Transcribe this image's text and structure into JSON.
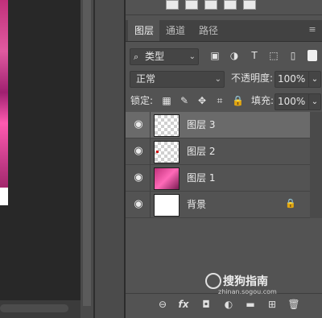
{
  "panel": {
    "tabs": [
      {
        "label": "图层",
        "active": true
      },
      {
        "label": "通道",
        "active": false
      },
      {
        "label": "路径",
        "active": false
      }
    ],
    "menu_icon": "≡"
  },
  "filter": {
    "kind_label": "类型",
    "search_glyph": "⌕",
    "caret": "⌄"
  },
  "blend": {
    "mode": "正常",
    "opacity_label": "不透明度:",
    "opacity_value": "100%"
  },
  "lock": {
    "label": "锁定:",
    "fill_label": "填充:",
    "fill_value": "100%"
  },
  "layers": [
    {
      "name": "图层 3",
      "selected": true,
      "thumb": "checker"
    },
    {
      "name": "图层 2",
      "selected": false,
      "thumb": "checker"
    },
    {
      "name": "图层 1",
      "selected": false,
      "thumb": "photo"
    },
    {
      "name": "背景",
      "selected": false,
      "thumb": "white",
      "locked": true
    }
  ],
  "glyphs": {
    "eye": "◉",
    "lock": "🔒",
    "fx": "fx",
    "link": "⊖",
    "mask": "◘",
    "adjust": "◐",
    "folder": "▬",
    "new": "⊞",
    "trash": "🗑",
    "image": "▣",
    "circle": "◑",
    "text": "T",
    "shape": "⬚",
    "smart": "▯",
    "lock_pixels": "▦",
    "brush": "✎",
    "move": "✥",
    "artboard": "⌗"
  },
  "watermark": {
    "text": "搜狗指南",
    "sub": "zhinan.sogou.com"
  },
  "colors": {
    "panel": "#535353",
    "tabbar": "#424242",
    "selected_layer": "#6a6a6a",
    "canvas_bg": "#282828"
  }
}
